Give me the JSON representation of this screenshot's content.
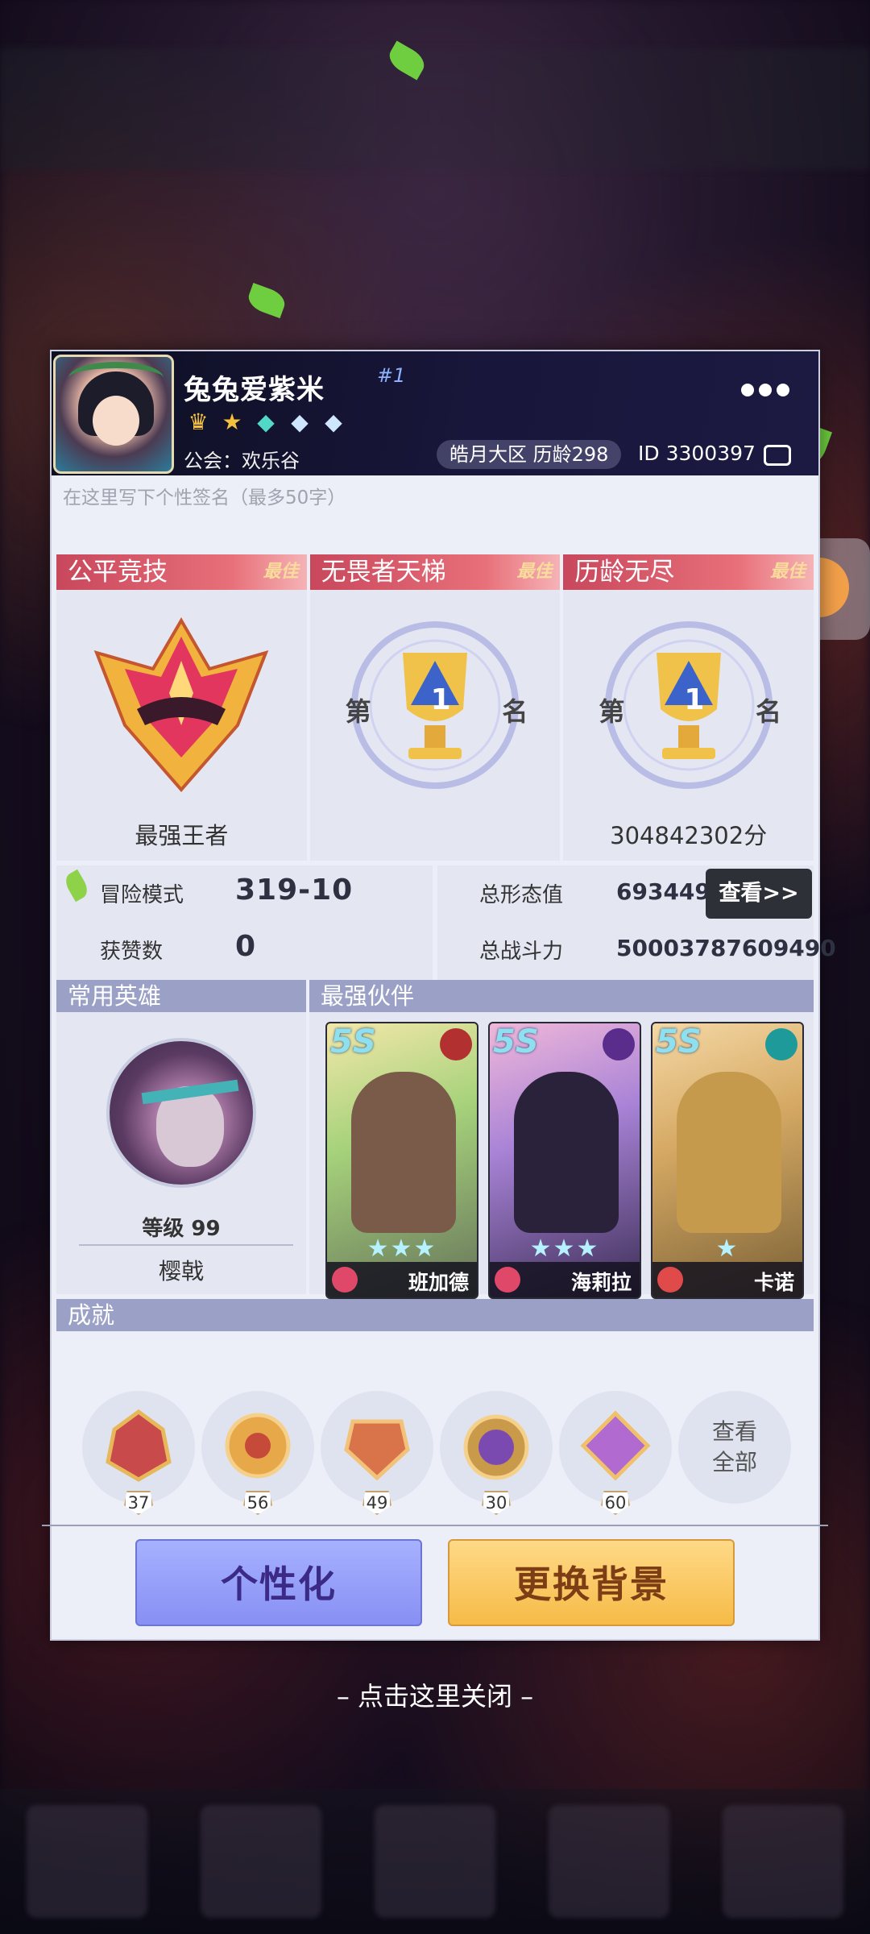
{
  "profile": {
    "username": "兔兔爱紫米",
    "rank_tag": "#1",
    "guild": "公会：欢乐谷",
    "server_pill": "皓月大区  历龄298",
    "user_id": "ID 3300397",
    "signature_placeholder": "在这里写下个性签名（最多50字）",
    "badges": [
      "crown-badge-icon",
      "star-badge-icon",
      "diamond-badge-icon",
      "diamond-badge-icon",
      "diamond-badge-icon"
    ]
  },
  "ranks": [
    {
      "title": "公平竞技",
      "best": "最佳",
      "value": "最强王者"
    },
    {
      "title": "无畏者天梯",
      "best": "最佳",
      "value": ""
    },
    {
      "title": "历龄无尽",
      "best": "最佳",
      "value": "304842302分"
    }
  ],
  "trophy": {
    "left": "第",
    "number": "1",
    "right": "名"
  },
  "stats": {
    "adventure_label": "冒险模式",
    "adventure_value": "319-10",
    "likes_label": "获赞数",
    "likes_value": "0",
    "form_label": "总形态值",
    "form_value": "693449",
    "view_button": "查看>>",
    "power_label": "总战斗力",
    "power_value": "50003787609490"
  },
  "heroes": {
    "common_title": "常用英雄",
    "level": "等级 99",
    "hero_name": "樱戟",
    "strongest_title": "最强伙伴",
    "partners": [
      {
        "tier": "5S",
        "stars": "★★★",
        "name": "班加德"
      },
      {
        "tier": "5S",
        "stars": "★★★",
        "name": "海莉拉"
      },
      {
        "tier": "5S",
        "stars": "★",
        "name": "卡诺"
      }
    ]
  },
  "achievements": {
    "title": "成就",
    "items": [
      {
        "count": "37",
        "color": "#c94a4a"
      },
      {
        "count": "56",
        "color": "#e7a84a"
      },
      {
        "count": "49",
        "color": "#d9734a"
      },
      {
        "count": "30",
        "color": "#c99a4a"
      },
      {
        "count": "60",
        "color": "#b06ad0"
      }
    ],
    "view_all_1": "查看",
    "view_all_2": "全部"
  },
  "buttons": {
    "customize": "个性化",
    "change_bg": "更换背景"
  },
  "close_hint": "– 点击这里关闭 –",
  "colors": {
    "rank_head": "#c8475c",
    "section_head": "#9ba1c6",
    "customize_btn": "#8790f3",
    "background_btn": "#f6bb47"
  }
}
